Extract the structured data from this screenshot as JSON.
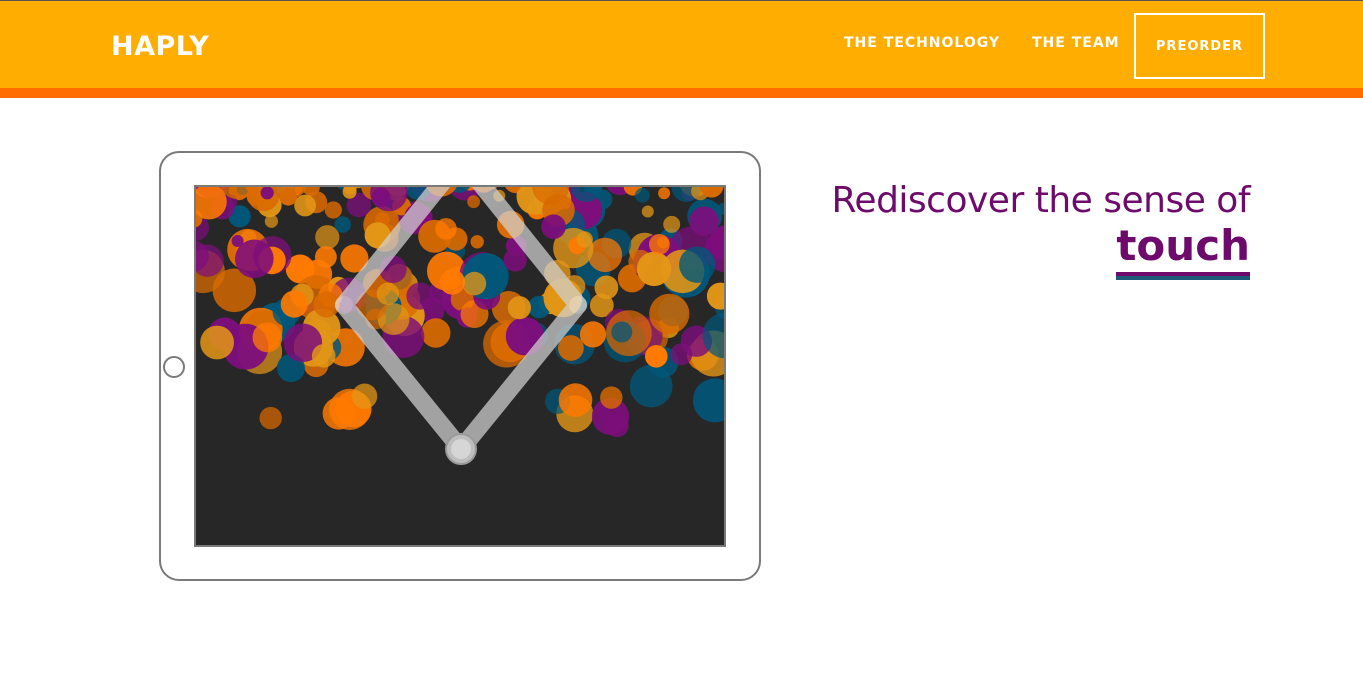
{
  "brand": {
    "logo_text": "HAPLY",
    "primary_color": "#ffad00",
    "stripe_color": "#ff6c00"
  },
  "nav": {
    "items": [
      {
        "label": "THE TECHNOLOGY"
      },
      {
        "label": "THE TEAM"
      }
    ],
    "cta_label": "PREORDER"
  },
  "hero": {
    "headline_text": "Rediscover the sense of",
    "headline_accent": "touch",
    "headline_color": "#6d0a6b",
    "underline_color": "#1e5a78"
  },
  "illustration": {
    "device": "tablet",
    "screen_background": "#272727",
    "bubble_colors": [
      "#ff7a00",
      "#e39616",
      "#7d0e7c",
      "#00577a",
      "#d96a00"
    ],
    "linkage_color": "#c8c8c8",
    "icons": [
      "tablet-home-button-icon",
      "haptic-linkage-icon"
    ]
  }
}
